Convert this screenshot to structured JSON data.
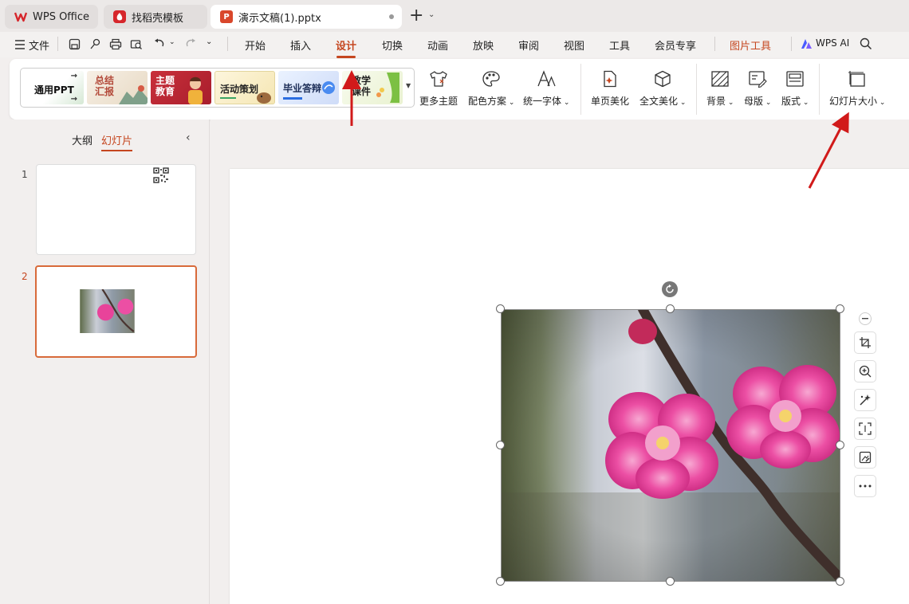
{
  "tabs": [
    {
      "label": "WPS Office"
    },
    {
      "label": "找稻壳模板"
    },
    {
      "label": "演示文稿(1).pptx"
    }
  ],
  "menu": {
    "file": "文件",
    "items": [
      "开始",
      "插入",
      "设计",
      "切换",
      "动画",
      "放映",
      "审阅",
      "视图",
      "工具",
      "会员专享"
    ],
    "selected": "设计",
    "context_tab": "图片工具",
    "ai": "WPS AI"
  },
  "ribbon": {
    "themes": [
      {
        "label": "通用PPT"
      },
      {
        "label": "总结\n汇报"
      },
      {
        "label": "主题\n教育"
      },
      {
        "label": "活动策划"
      },
      {
        "label": "毕业答辩"
      },
      {
        "label": "教学\n课件"
      }
    ],
    "buttons": {
      "more_themes": "更多主题",
      "color_scheme": "配色方案",
      "unify_font": "统一字体",
      "beautify_page": "单页美化",
      "beautify_all": "全文美化",
      "background": "背景",
      "master": "母版",
      "layout": "版式",
      "slide_size": "幻灯片大小"
    }
  },
  "left_panel": {
    "tab_outline": "大纲",
    "tab_slides": "幻灯片",
    "slide_numbers": [
      "1",
      "2"
    ]
  },
  "colors": {
    "accent": "#c5461f",
    "annotation_arrow": "#d11a1a",
    "blossom": "#e8439a"
  }
}
